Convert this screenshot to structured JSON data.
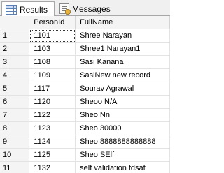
{
  "tabs": {
    "results": {
      "label": "Results",
      "icon": "grid-icon"
    },
    "messages": {
      "label": "Messages",
      "icon": "messages-icon"
    }
  },
  "grid": {
    "columns": [
      "",
      "PersonId",
      "FullName"
    ],
    "rows": [
      {
        "n": "1",
        "id": "1101",
        "name": "Shree Narayan"
      },
      {
        "n": "2",
        "id": "1103",
        "name": "Shree1 Narayan1"
      },
      {
        "n": "3",
        "id": "1108",
        "name": "Sasi Kanana"
      },
      {
        "n": "4",
        "id": "1109",
        "name": "SasiNew new record"
      },
      {
        "n": "5",
        "id": "1117",
        "name": "Sourav Agrawal"
      },
      {
        "n": "6",
        "id": "1120",
        "name": "Sheoo N/A"
      },
      {
        "n": "7",
        "id": "1122",
        "name": "Sheo Nn"
      },
      {
        "n": "8",
        "id": "1123",
        "name": "Sheo 30000"
      },
      {
        "n": "9",
        "id": "1124",
        "name": "Sheo 8888888888888"
      },
      {
        "n": "10",
        "id": "1125",
        "name": "Sheo SElf"
      },
      {
        "n": "11",
        "id": "1132",
        "name": "self validation fdsaf"
      }
    ]
  }
}
